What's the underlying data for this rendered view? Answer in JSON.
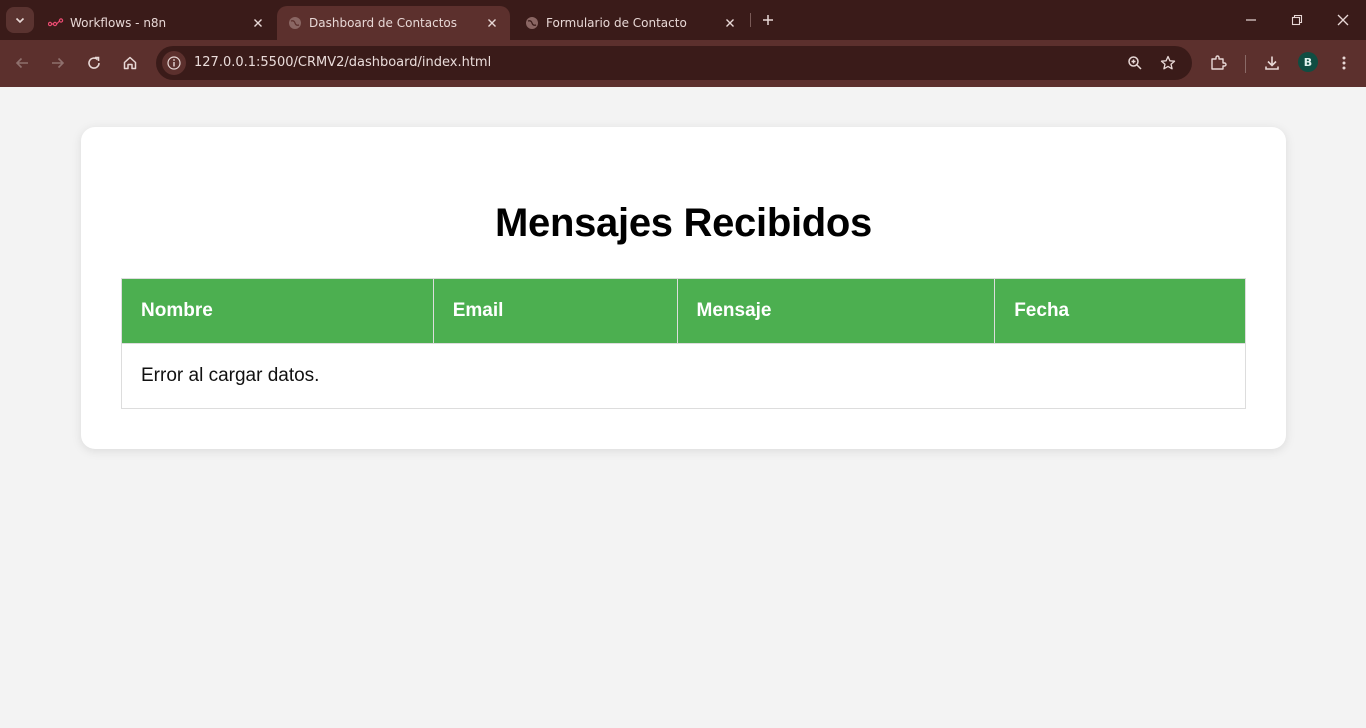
{
  "browser": {
    "tabs": [
      {
        "title": "Workflows - n8n",
        "icon": "n8n-logo-icon"
      },
      {
        "title": "Dashboard de Contactos",
        "icon": "globe-icon",
        "active": true
      },
      {
        "title": "Formulario de Contacto",
        "icon": "globe-icon"
      }
    ],
    "url": "127.0.0.1:5500/CRMV2/dashboard/index.html",
    "profile_initial": "B",
    "colors": {
      "frame": "#3a1b19",
      "toolbar": "#5c302d",
      "avatar": "#0f4d42"
    }
  },
  "page": {
    "title": "Mensajes Recibidos",
    "table": {
      "headers": [
        "Nombre",
        "Email",
        "Mensaje",
        "Fecha"
      ],
      "error_message": "Error al cargar datos."
    },
    "colors": {
      "header_bg": "#4caf50",
      "background": "#f3f3f3"
    }
  }
}
